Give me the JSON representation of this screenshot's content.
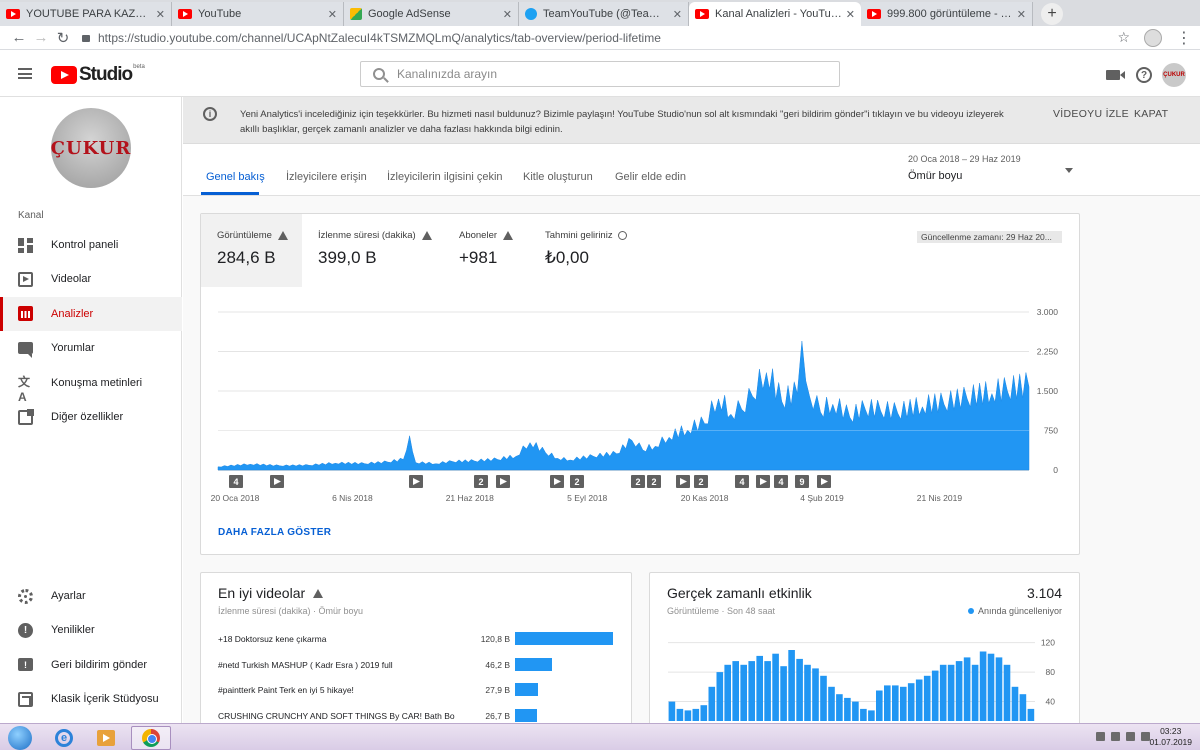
{
  "browser": {
    "tabs": [
      {
        "label": "YOUTUBE PARA KAZANMA AKTİF",
        "favicon": "youtube-icon",
        "active": false
      },
      {
        "label": "YouTube",
        "favicon": "youtube-icon",
        "active": false
      },
      {
        "label": "Google AdSense",
        "favicon": "adsense-icon",
        "active": false
      },
      {
        "label": "TeamYouTube (@TeamYouTube)",
        "favicon": "twitter-icon",
        "active": false
      },
      {
        "label": "Kanal Analizleri - YouTube Studio",
        "favicon": "youtube-icon",
        "active": true
      },
      {
        "label": "999.800 görüntüleme - YouTube",
        "favicon": "youtube-icon",
        "active": false
      }
    ],
    "url": "https://studio.youtube.com/channel/UCApNtZalecuI4kTSMZMQLmQ/analytics/tab-overview/period-lifetime"
  },
  "header": {
    "logo_text": "Studio",
    "beta": "beta",
    "search_placeholder": "Kanalınızda arayın",
    "avatar_text": "ÇUKUR"
  },
  "sidebar": {
    "channel_avatar_text": "ÇUKUR",
    "section_label": "Kanal",
    "items": [
      {
        "label": "Kontrol paneli",
        "icon": "dashboard-icon"
      },
      {
        "label": "Videolar",
        "icon": "videos-icon"
      },
      {
        "label": "Analizler",
        "icon": "analytics-icon",
        "active": true
      },
      {
        "label": "Yorumlar",
        "icon": "comments-icon"
      },
      {
        "label": "Konuşma metinleri",
        "icon": "transcripts-icon"
      },
      {
        "label": "Diğer özellikler",
        "icon": "other-features-icon"
      }
    ],
    "bottom_items": [
      {
        "label": "Ayarlar",
        "icon": "settings-icon"
      },
      {
        "label": "Yenilikler",
        "icon": "whats-new-icon"
      },
      {
        "label": "Geri bildirim gönder",
        "icon": "feedback-icon"
      },
      {
        "label": "Klasik İçerik Stüdyosu",
        "icon": "classic-studio-icon"
      }
    ]
  },
  "banner": {
    "text": "Yeni Analytics'i incelediğiniz için teşekkürler. Bu hizmeti nasıl buldunuz? Bizimle paylaşın! YouTube Studio'nun sol alt kısmındaki \"geri bildirim gönder\"i tıklayın ve bu videoyu izleyerek akıllı başlıklar, gerçek zamanlı analizler ve daha fazlası hakkında bilgi edinin.",
    "watch_btn": "VİDEOYU İZLE",
    "close_btn": "KAPAT"
  },
  "tabs": [
    "Genel bakış",
    "İzleyicilere erişin",
    "İzleyicilerin ilgisini çekin",
    "Kitle oluşturun",
    "Gelir elde edin"
  ],
  "period": {
    "range": "20 Oca 2018 – 29 Haz 2019",
    "value": "Ömür boyu"
  },
  "metrics": [
    {
      "label": "Görüntüleme",
      "value": "284,6 B",
      "icon": "warning-icon"
    },
    {
      "label": "İzlenme süresi (dakika)",
      "value": "399,0 B",
      "icon": "warning-icon"
    },
    {
      "label": "Aboneler",
      "value": "+981",
      "icon": "warning-icon"
    },
    {
      "label": "Tahmini geliriniz",
      "value": "₺0,00",
      "icon": "clock-icon"
    }
  ],
  "update_badge": "Güncellenme zamanı: 29 Haz 20...",
  "show_more": "DAHA FAZLA GÖSTER",
  "chart_data": [
    {
      "type": "area",
      "x_ticks": [
        "20 Oca 2018",
        "6 Nis 2018",
        "21 Haz 2018",
        "5 Eyl 2018",
        "20 Kas 2018",
        "4 Şub 2019",
        "21 Nis 2019"
      ],
      "y_ticks": [
        "3.000",
        "2.250",
        "1.500",
        "750",
        "0"
      ],
      "ylim": [
        0,
        3000
      ],
      "grid": true,
      "x": [
        "2018-01-20",
        "2018-02-10",
        "2018-03-01",
        "2018-03-20",
        "2018-04-06",
        "2018-04-25",
        "2018-05-10",
        "2018-05-20",
        "2018-05-24",
        "2018-05-28",
        "2018-06-10",
        "2018-06-21",
        "2018-07-05",
        "2018-07-20",
        "2018-08-01",
        "2018-08-10",
        "2018-08-20",
        "2018-08-28",
        "2018-09-05",
        "2018-09-20",
        "2018-10-05",
        "2018-10-15",
        "2018-10-22",
        "2018-10-30",
        "2018-11-08",
        "2018-11-20",
        "2018-12-01",
        "2018-12-10",
        "2018-12-18",
        "2018-12-25",
        "2019-01-01",
        "2019-01-10",
        "2019-01-20",
        "2019-01-30",
        "2019-02-02",
        "2019-02-07",
        "2019-02-14",
        "2019-02-22",
        "2019-03-05",
        "2019-03-15",
        "2019-03-25",
        "2019-04-05",
        "2019-04-21",
        "2019-05-05",
        "2019-05-20",
        "2019-06-05",
        "2019-06-15",
        "2019-06-29"
      ],
      "values": [
        60,
        110,
        80,
        90,
        130,
        120,
        150,
        200,
        650,
        140,
        120,
        160,
        170,
        200,
        260,
        520,
        330,
        220,
        190,
        260,
        310,
        560,
        380,
        450,
        620,
        760,
        880,
        1350,
        1060,
        1150,
        1400,
        1850,
        1300,
        1450,
        2450,
        1400,
        1100,
        1250,
        1000,
        1150,
        1120,
        1080,
        1200,
        1250,
        1350,
        1450,
        1500,
        1580
      ],
      "markers": [
        "4",
        "play",
        "play",
        "2",
        "play",
        "play",
        "2",
        "2",
        "2",
        "play",
        "2",
        "4",
        "play",
        "4",
        "9",
        "play"
      ]
    },
    {
      "type": "bar",
      "title": "En iyi videolar",
      "subtitle": "İzlenme süresi (dakika) · Ömür boyu",
      "categories": [
        "+18 Doktorsuz kene çıkarma",
        "#netd Turkish MASHUP ( Kadr Esra ) 2019 full",
        "#paintterk Paint Terk en iyi 5 hikaye!",
        "CRUSHING CRUNCHY AND SOFT THINGS By CAR! Bath Bo"
      ],
      "values": [
        120800,
        46200,
        27900,
        26700
      ],
      "labels": [
        "120,8 B",
        "46,2 B",
        "27,9 B",
        "26,7 B"
      ]
    },
    {
      "type": "bar",
      "title": "Gerçek zamanlı etkinlik",
      "subtitle": "Görüntüleme · Son 48 saat",
      "total": "3.104",
      "live_label": "Anında güncelleniyor",
      "y_ticks": [
        "120",
        "80",
        "40",
        "0"
      ],
      "ylim": [
        0,
        125
      ],
      "values": [
        40,
        30,
        28,
        30,
        35,
        60,
        80,
        90,
        95,
        90,
        95,
        102,
        95,
        105,
        88,
        110,
        98,
        90,
        85,
        75,
        60,
        50,
        45,
        40,
        30,
        28,
        55,
        62,
        62,
        60,
        65,
        70,
        75,
        82,
        90,
        90,
        95,
        100,
        90,
        108,
        105,
        100,
        90,
        60,
        50,
        30
      ]
    }
  ],
  "taskbar": {
    "time": "03:23",
    "date": "01.07.2019"
  }
}
